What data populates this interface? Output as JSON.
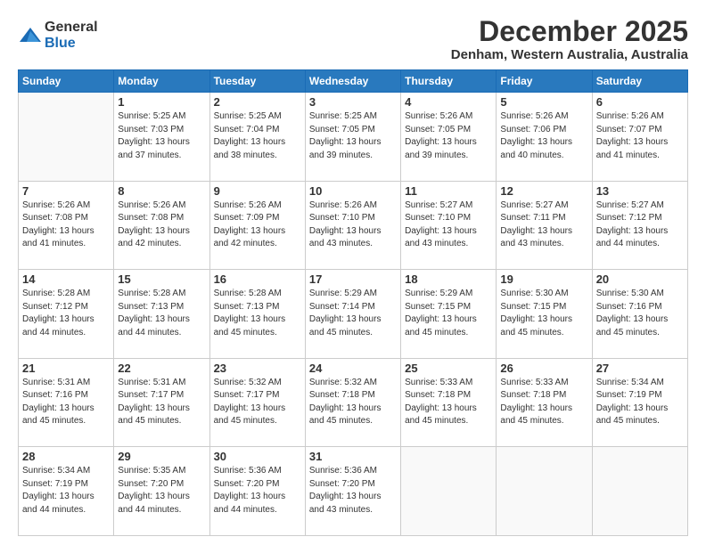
{
  "logo": {
    "general": "General",
    "blue": "Blue"
  },
  "title": "December 2025",
  "subtitle": "Denham, Western Australia, Australia",
  "days_header": [
    "Sunday",
    "Monday",
    "Tuesday",
    "Wednesday",
    "Thursday",
    "Friday",
    "Saturday"
  ],
  "weeks": [
    [
      {
        "day": "",
        "sunrise": "",
        "sunset": "",
        "daylight": ""
      },
      {
        "day": "1",
        "sunrise": "5:25 AM",
        "sunset": "7:03 PM",
        "daylight": "13 hours and 37 minutes."
      },
      {
        "day": "2",
        "sunrise": "5:25 AM",
        "sunset": "7:04 PM",
        "daylight": "13 hours and 38 minutes."
      },
      {
        "day": "3",
        "sunrise": "5:25 AM",
        "sunset": "7:05 PM",
        "daylight": "13 hours and 39 minutes."
      },
      {
        "day": "4",
        "sunrise": "5:26 AM",
        "sunset": "7:05 PM",
        "daylight": "13 hours and 39 minutes."
      },
      {
        "day": "5",
        "sunrise": "5:26 AM",
        "sunset": "7:06 PM",
        "daylight": "13 hours and 40 minutes."
      },
      {
        "day": "6",
        "sunrise": "5:26 AM",
        "sunset": "7:07 PM",
        "daylight": "13 hours and 41 minutes."
      }
    ],
    [
      {
        "day": "7",
        "sunrise": "5:26 AM",
        "sunset": "7:08 PM",
        "daylight": "13 hours and 41 minutes."
      },
      {
        "day": "8",
        "sunrise": "5:26 AM",
        "sunset": "7:08 PM",
        "daylight": "13 hours and 42 minutes."
      },
      {
        "day": "9",
        "sunrise": "5:26 AM",
        "sunset": "7:09 PM",
        "daylight": "13 hours and 42 minutes."
      },
      {
        "day": "10",
        "sunrise": "5:26 AM",
        "sunset": "7:10 PM",
        "daylight": "13 hours and 43 minutes."
      },
      {
        "day": "11",
        "sunrise": "5:27 AM",
        "sunset": "7:10 PM",
        "daylight": "13 hours and 43 minutes."
      },
      {
        "day": "12",
        "sunrise": "5:27 AM",
        "sunset": "7:11 PM",
        "daylight": "13 hours and 43 minutes."
      },
      {
        "day": "13",
        "sunrise": "5:27 AM",
        "sunset": "7:12 PM",
        "daylight": "13 hours and 44 minutes."
      }
    ],
    [
      {
        "day": "14",
        "sunrise": "5:28 AM",
        "sunset": "7:12 PM",
        "daylight": "13 hours and 44 minutes."
      },
      {
        "day": "15",
        "sunrise": "5:28 AM",
        "sunset": "7:13 PM",
        "daylight": "13 hours and 44 minutes."
      },
      {
        "day": "16",
        "sunrise": "5:28 AM",
        "sunset": "7:13 PM",
        "daylight": "13 hours and 45 minutes."
      },
      {
        "day": "17",
        "sunrise": "5:29 AM",
        "sunset": "7:14 PM",
        "daylight": "13 hours and 45 minutes."
      },
      {
        "day": "18",
        "sunrise": "5:29 AM",
        "sunset": "7:15 PM",
        "daylight": "13 hours and 45 minutes."
      },
      {
        "day": "19",
        "sunrise": "5:30 AM",
        "sunset": "7:15 PM",
        "daylight": "13 hours and 45 minutes."
      },
      {
        "day": "20",
        "sunrise": "5:30 AM",
        "sunset": "7:16 PM",
        "daylight": "13 hours and 45 minutes."
      }
    ],
    [
      {
        "day": "21",
        "sunrise": "5:31 AM",
        "sunset": "7:16 PM",
        "daylight": "13 hours and 45 minutes."
      },
      {
        "day": "22",
        "sunrise": "5:31 AM",
        "sunset": "7:17 PM",
        "daylight": "13 hours and 45 minutes."
      },
      {
        "day": "23",
        "sunrise": "5:32 AM",
        "sunset": "7:17 PM",
        "daylight": "13 hours and 45 minutes."
      },
      {
        "day": "24",
        "sunrise": "5:32 AM",
        "sunset": "7:18 PM",
        "daylight": "13 hours and 45 minutes."
      },
      {
        "day": "25",
        "sunrise": "5:33 AM",
        "sunset": "7:18 PM",
        "daylight": "13 hours and 45 minutes."
      },
      {
        "day": "26",
        "sunrise": "5:33 AM",
        "sunset": "7:18 PM",
        "daylight": "13 hours and 45 minutes."
      },
      {
        "day": "27",
        "sunrise": "5:34 AM",
        "sunset": "7:19 PM",
        "daylight": "13 hours and 45 minutes."
      }
    ],
    [
      {
        "day": "28",
        "sunrise": "5:34 AM",
        "sunset": "7:19 PM",
        "daylight": "13 hours and 44 minutes."
      },
      {
        "day": "29",
        "sunrise": "5:35 AM",
        "sunset": "7:20 PM",
        "daylight": "13 hours and 44 minutes."
      },
      {
        "day": "30",
        "sunrise": "5:36 AM",
        "sunset": "7:20 PM",
        "daylight": "13 hours and 44 minutes."
      },
      {
        "day": "31",
        "sunrise": "5:36 AM",
        "sunset": "7:20 PM",
        "daylight": "13 hours and 43 minutes."
      },
      {
        "day": "",
        "sunrise": "",
        "sunset": "",
        "daylight": ""
      },
      {
        "day": "",
        "sunrise": "",
        "sunset": "",
        "daylight": ""
      },
      {
        "day": "",
        "sunrise": "",
        "sunset": "",
        "daylight": ""
      }
    ]
  ]
}
